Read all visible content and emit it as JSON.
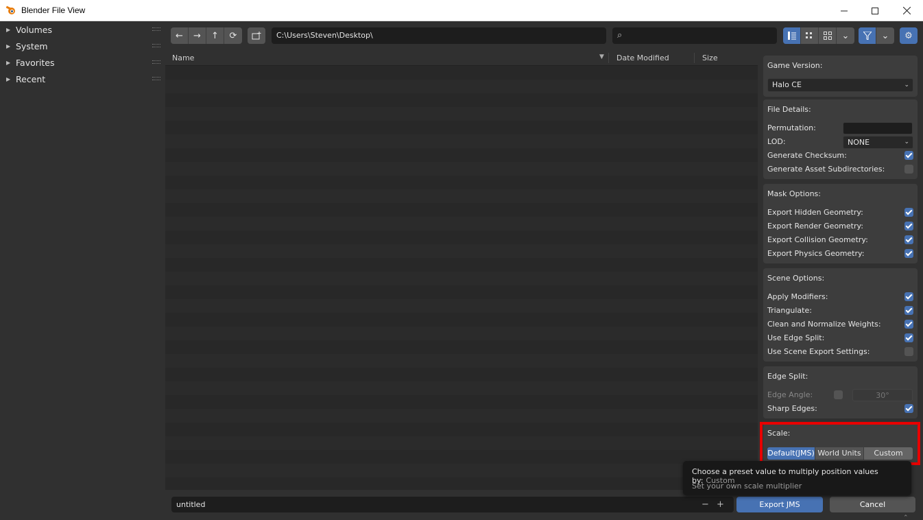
{
  "window": {
    "title": "Blender File View",
    "min_icon": "minimize-icon",
    "max_icon": "maximize-icon",
    "close_icon": "close-icon"
  },
  "sidebar": {
    "items": [
      {
        "label": "Volumes"
      },
      {
        "label": "System"
      },
      {
        "label": "Favorites"
      },
      {
        "label": "Recent"
      }
    ]
  },
  "toolbar": {
    "path": "C:\\Users\\Steven\\Desktop\\",
    "search_placeholder": ""
  },
  "filelist": {
    "columns": {
      "name": "Name",
      "date": "Date Modified",
      "size": "Size"
    }
  },
  "bottom": {
    "filename": "untitled",
    "export_label": "Export JMS",
    "cancel_label": "Cancel",
    "minus": "−",
    "plus": "+"
  },
  "panel": {
    "game_version": {
      "header": "Game Version:",
      "value": "Halo CE"
    },
    "file_details": {
      "header": "File Details:",
      "permutation": "Permutation:",
      "lod": "LOD:",
      "lod_value": "NONE",
      "checksum": "Generate Checksum:",
      "asset_subdirs": "Generate Asset Subdirectories:"
    },
    "mask": {
      "header": "Mask Options:",
      "hidden": "Export Hidden Geometry:",
      "render": "Export Render Geometry:",
      "collision": "Export Collision Geometry:",
      "physics": "Export Physics Geometry:"
    },
    "scene": {
      "header": "Scene Options:",
      "modifiers": "Apply Modifiers:",
      "triangulate": "Triangulate:",
      "weights": "Clean and Normalize Weights:",
      "edge_split": "Use Edge Split:",
      "scene_export": "Use Scene Export Settings:"
    },
    "edge": {
      "header": "Edge Split:",
      "angle": "Edge Angle:",
      "angle_value": "30°",
      "sharp": "Sharp Edges:"
    },
    "scale": {
      "header": "Scale:",
      "options": [
        "Default(JMS)",
        "World Units",
        "Custom"
      ]
    }
  },
  "tooltip": {
    "line1": "Choose a preset value to multiply position values by:",
    "value": "Custom",
    "line2": "Set your own scale multiplier"
  },
  "colors": {
    "accent": "#4772b3",
    "highlight": "#e80000"
  }
}
